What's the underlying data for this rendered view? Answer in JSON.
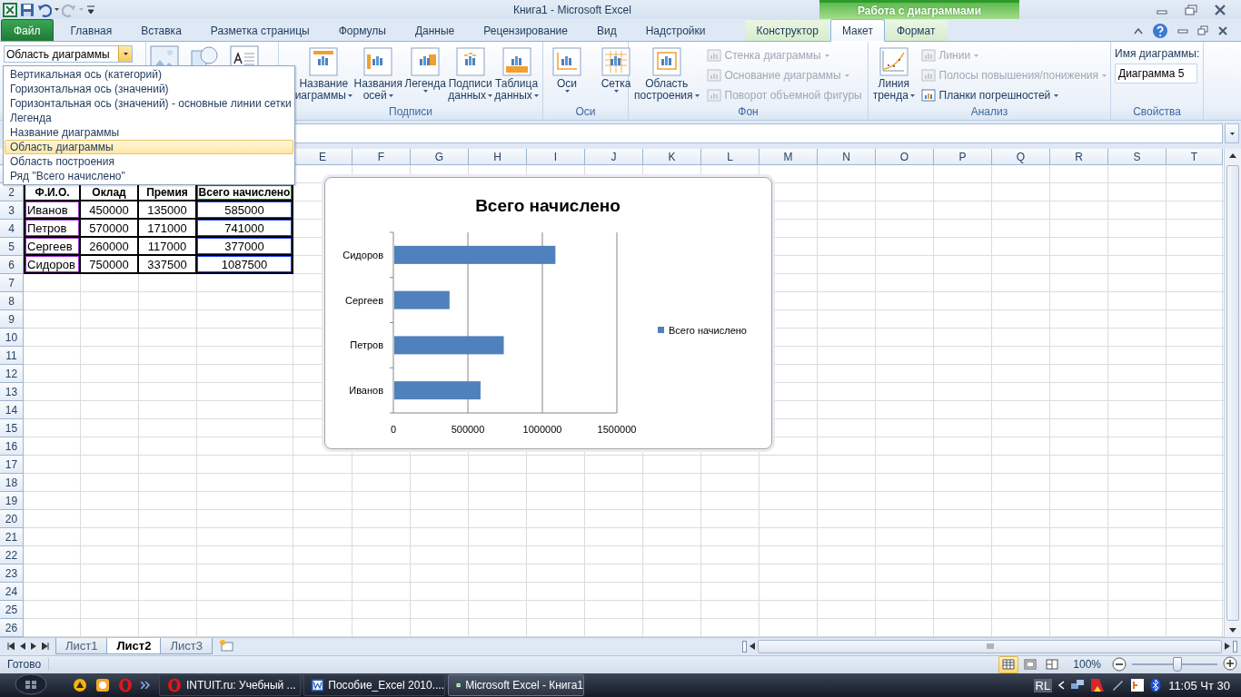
{
  "title_bar": {
    "title": "Книга1  -  Microsoft Excel",
    "context_group": "Работа с диаграммами"
  },
  "menu_tabs": [
    {
      "label": "Файл",
      "kind": "file",
      "selected": false
    },
    {
      "label": "Главная",
      "kind": "tab",
      "selected": false
    },
    {
      "label": "Вставка",
      "kind": "tab",
      "selected": false
    },
    {
      "label": "Разметка страницы",
      "kind": "tab",
      "selected": false
    },
    {
      "label": "Формулы",
      "kind": "tab",
      "selected": false
    },
    {
      "label": "Данные",
      "kind": "tab",
      "selected": false
    },
    {
      "label": "Рецензирование",
      "kind": "tab",
      "selected": false
    },
    {
      "label": "Вид",
      "kind": "tab",
      "selected": false
    },
    {
      "label": "Надстройки",
      "kind": "tab",
      "selected": false
    },
    {
      "label": "Конструктор",
      "kind": "context",
      "selected": false
    },
    {
      "label": "Макет",
      "kind": "context",
      "selected": true
    },
    {
      "label": "Формат",
      "kind": "context",
      "selected": false
    }
  ],
  "ribbon": {
    "name_box": {
      "value": "Область диаграммы"
    },
    "insert_items": [
      {
        "kind": "picture"
      },
      {
        "kind": "shapes"
      },
      {
        "kind": "textbox"
      }
    ],
    "groups": [
      {
        "kind": "large",
        "label": "Подписи",
        "buttons": [
          {
            "lines": [
              "Название",
              "иаграммы"
            ],
            "kind": "title"
          },
          {
            "lines": [
              "Названия",
              "осей"
            ],
            "kind": "axis-titles"
          },
          {
            "lines": [
              "Легенда"
            ],
            "kind": "legend"
          },
          {
            "lines": [
              "Подписи",
              "данных"
            ],
            "kind": "labels"
          },
          {
            "lines": [
              "Таблица",
              "данных"
            ],
            "kind": "table"
          }
        ]
      },
      {
        "kind": "large",
        "label": "Оси",
        "buttons": [
          {
            "lines": [
              "Оси"
            ],
            "kind": "axes"
          },
          {
            "lines": [
              "Сетка"
            ],
            "kind": "grid"
          }
        ]
      },
      {
        "kind": "mixed",
        "label": "Фон",
        "buttons": [
          {
            "lines": [
              "Область",
              "построения"
            ],
            "kind": "plot"
          }
        ],
        "small": [
          {
            "label": "Стенка диаграммы",
            "disabled": true,
            "caret": true
          },
          {
            "label": "Основание диаграммы",
            "disabled": true,
            "caret": true
          },
          {
            "label": "Поворот объемной фигуры",
            "disabled": true,
            "caret": false
          }
        ]
      },
      {
        "kind": "mixed",
        "label": "Анализ",
        "buttons": [
          {
            "lines": [
              "Линия",
              "тренда"
            ],
            "kind": "trend"
          }
        ],
        "small": [
          {
            "label": "Линии",
            "disabled": true,
            "caret": true
          },
          {
            "label": "Полосы повышения/понижения",
            "disabled": true,
            "caret": true
          },
          {
            "label": "Планки погрешностей",
            "disabled": false,
            "caret": true
          }
        ]
      },
      {
        "kind": "properties",
        "label": "Свойства",
        "field_label": "Имя диаграммы:",
        "value": "Диаграмма 5"
      }
    ]
  },
  "element_dropdown": {
    "items": [
      {
        "label": "Вертикальная ось (категорий)",
        "selected": false
      },
      {
        "label": "Горизонтальная ось (значений)",
        "selected": false
      },
      {
        "label": "Горизонтальная ось (значений)  - основные линии сетки",
        "selected": false
      },
      {
        "label": "Легенда",
        "selected": false
      },
      {
        "label": "Название диаграммы",
        "selected": false
      },
      {
        "label": "Область диаграммы",
        "selected": true
      },
      {
        "label": "Область построения",
        "selected": false
      },
      {
        "label": "Ряд \"Всего начислено\"",
        "selected": false
      }
    ]
  },
  "sheet": {
    "column_headers": [
      "E",
      "F",
      "G",
      "H",
      "I",
      "J",
      "K",
      "L",
      "M",
      "N",
      "O",
      "P",
      "Q",
      "R",
      "S",
      "T"
    ],
    "row_numbers": [
      "2",
      "3",
      "4",
      "5",
      "6",
      "7",
      "8",
      "9",
      "10",
      "11",
      "12",
      "13",
      "14",
      "15",
      "16",
      "17",
      "18",
      "19",
      "20",
      "21",
      "22",
      "23",
      "24",
      "25",
      "26"
    ],
    "table": {
      "header": [
        "Ф.И.О.",
        "Оклад",
        "Премия",
        "Всего начислено"
      ],
      "rows": [
        [
          "Иванов",
          "450000",
          "135000",
          "585000"
        ],
        [
          "Петров",
          "570000",
          "171000",
          "741000"
        ],
        [
          "Сергеев",
          "260000",
          "117000",
          "377000"
        ],
        [
          "Сидоров",
          "750000",
          "337500",
          "1087500"
        ]
      ]
    }
  },
  "chart": {
    "chart_data": {
      "type": "bar",
      "orientation": "horizontal",
      "title": "Всего начислено",
      "categories": [
        "Сидоров",
        "Сергеев",
        "Петров",
        "Иванов"
      ],
      "series": [
        {
          "name": "Всего начислено",
          "color": "#4f81bd",
          "values": [
            1087500,
            377000,
            741000,
            585000
          ]
        }
      ],
      "xlim": [
        0,
        1500000
      ],
      "xticks": [
        0,
        500000,
        1000000,
        1500000
      ]
    }
  },
  "sheet_tabs": [
    {
      "label": "Лист1",
      "selected": false
    },
    {
      "label": "Лист2",
      "selected": true
    },
    {
      "label": "Лист3",
      "selected": false
    }
  ],
  "status_bar": {
    "status": "Готово",
    "views": [
      {
        "kind": "normal",
        "selected": true
      },
      {
        "kind": "layout",
        "selected": false
      },
      {
        "kind": "pagebreak",
        "selected": false
      }
    ],
    "zoom": "100%",
    "zoom_slider": {
      "level": 0.52
    }
  },
  "taskbar": {
    "tasks": [
      {
        "label": "INTUIT.ru: Учебный ...",
        "kind": "opera",
        "selected": false
      },
      {
        "label": "Пособие_Excel 2010....",
        "kind": "word",
        "selected": false
      },
      {
        "label": "Microsoft Excel - Книга1",
        "kind": "excel",
        "selected": true
      }
    ],
    "language": "RL",
    "clock": "11:05 Чт 30"
  }
}
